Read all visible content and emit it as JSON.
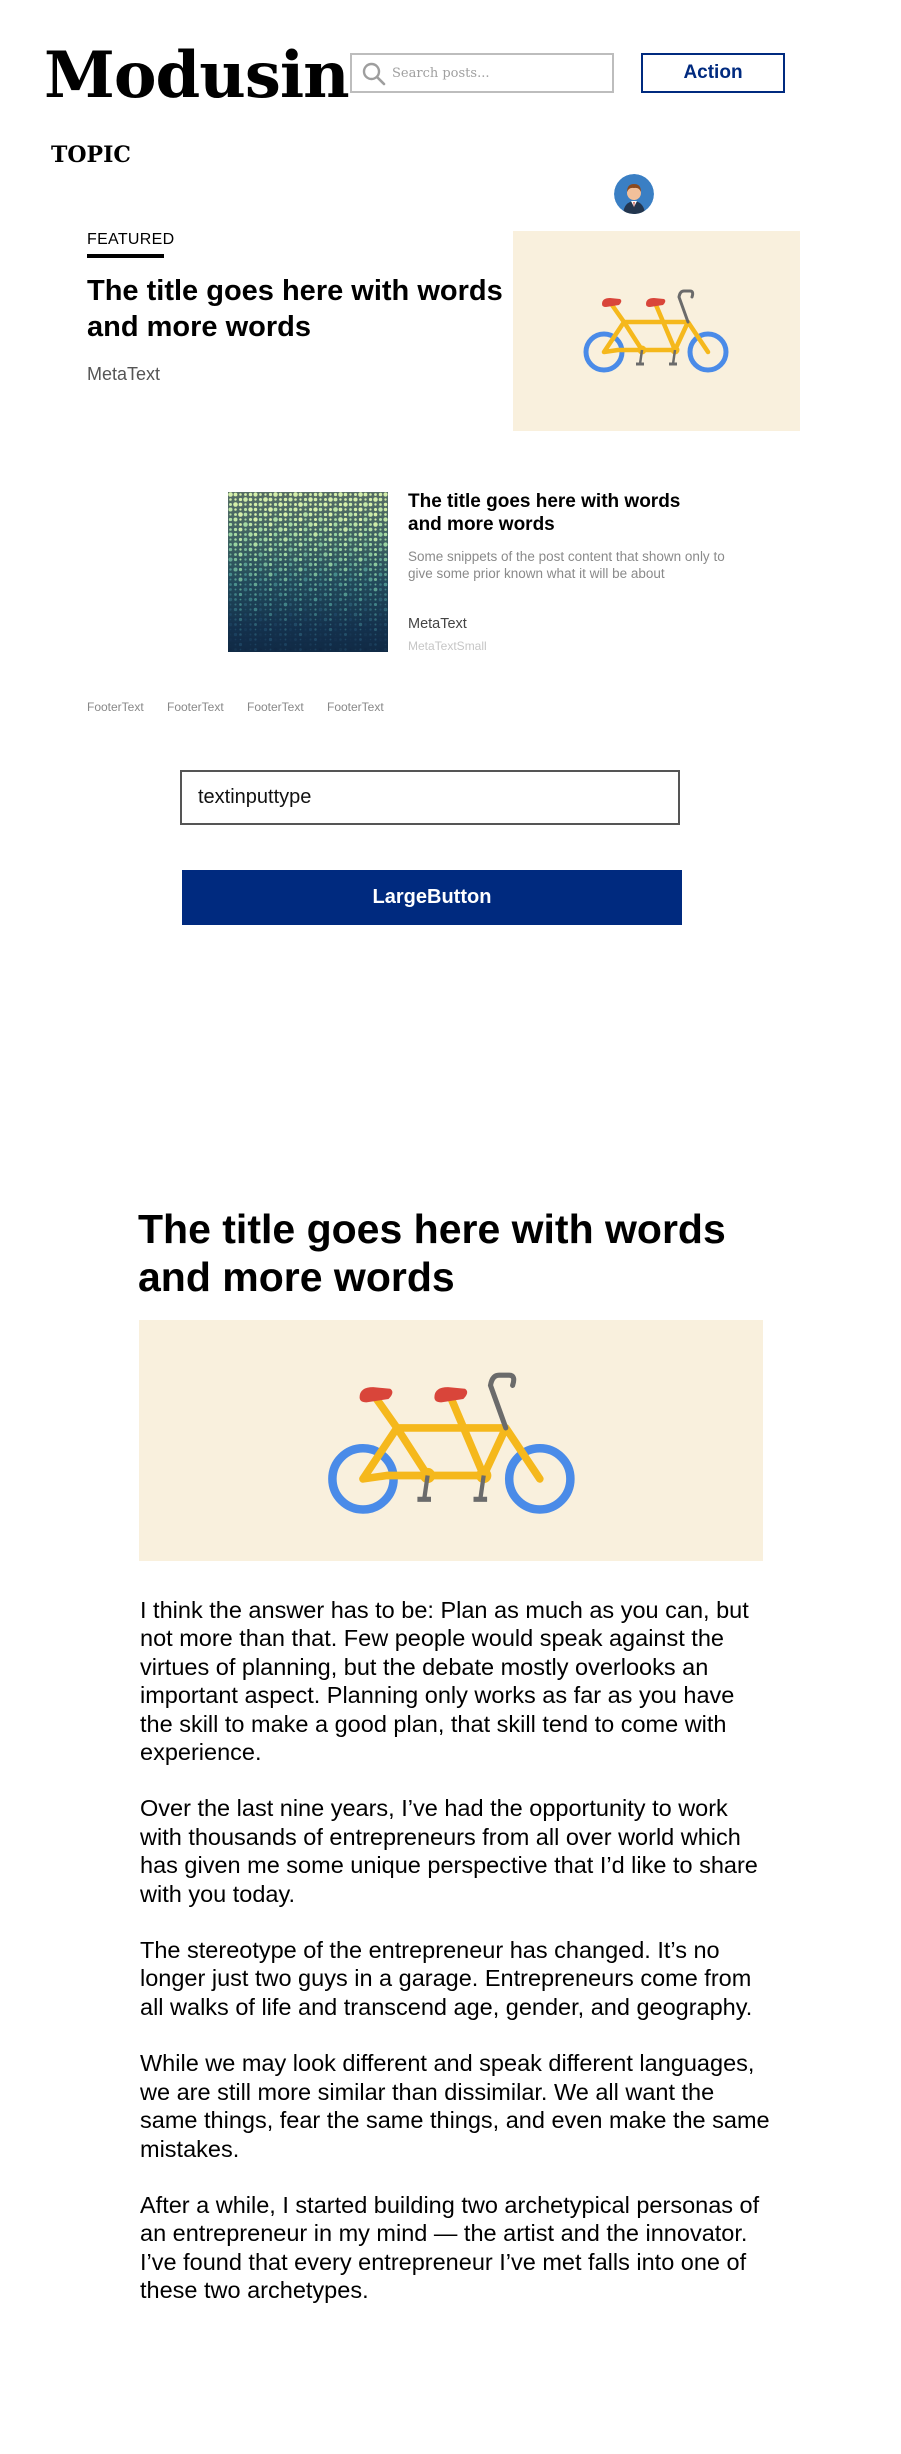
{
  "header": {
    "logo": "Modusin",
    "search_placeholder": "Search posts...",
    "action_label": "Action",
    "topic": "TOPIC"
  },
  "featured": {
    "label": "FEATURED",
    "title": "The title goes here with words and more words",
    "meta": "MetaText"
  },
  "card": {
    "title": "The title goes here with words and more words",
    "snippet": "Some snippets of the post content that shown only to give some prior known what it will be about",
    "meta": "MetaText",
    "meta_small": "MetaTextSmall"
  },
  "footer": {
    "links": [
      "FooterText",
      "FooterText",
      "FooterText",
      "FooterText"
    ]
  },
  "form": {
    "input_value": "textinputtype",
    "button_label": "LargeButton"
  },
  "article": {
    "title": "The title goes here with words and more words",
    "paragraphs": [
      "I think the answer has to be: Plan as much as you can, but not more than that. Few people would speak against the virtues of planning, but the debate mostly overlooks an important aspect. Planning only works as far as you have the skill to make a good plan, that skill tend to come with experience.",
      "Over the last nine years, I’ve had the opportunity to work with thousands of entrepreneurs from all over world which has given me some unique perspective that I’d like to share with you today.",
      "The stereotype of the entrepreneur has changed. It’s no longer just two guys in a garage. Entrepreneurs come from all walks of life and transcend age, gender, and geography.",
      "While we may look different and speak different languages, we are still more similar than dissimilar. We all want the same things, fear the same things, and even make the same mistakes.",
      "After a while, I started building two archetypical personas of an entrepreneur in my mind — the artist and the innovator. I’ve found that every entrepreneur I’ve met falls into one of these two archetypes."
    ]
  },
  "icons": {
    "search": "search-icon",
    "avatar": "avatar",
    "bicycle": "tandem-bicycle-illustration",
    "pattern": "dot-gradient-thumbnail"
  },
  "colors": {
    "brand_blue": "#002a7f",
    "image_bg": "#f9f0dd",
    "bike_frame": "#f5b81c",
    "bike_wheel": "#4a8be8",
    "bike_seat": "#d9453a"
  }
}
